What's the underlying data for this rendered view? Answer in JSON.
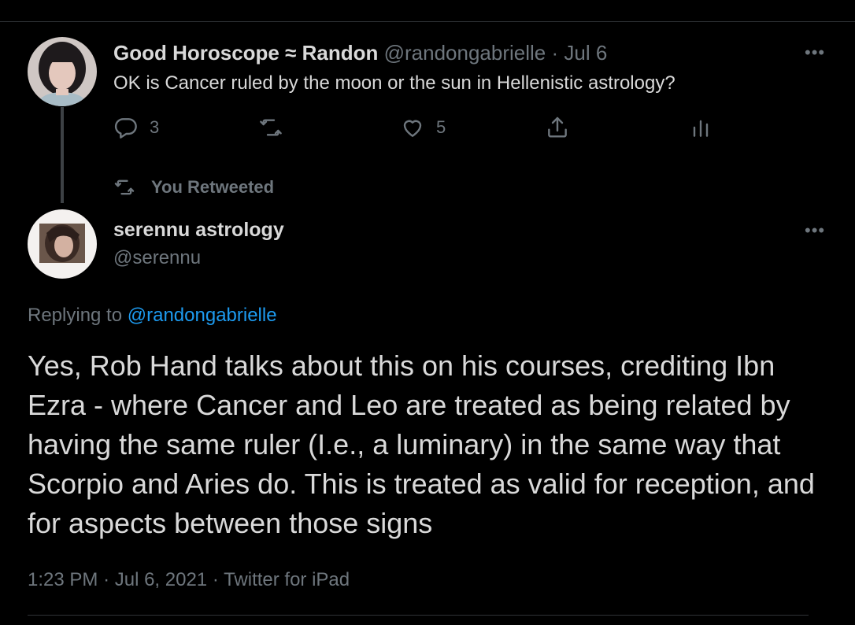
{
  "tweet1": {
    "display_name": "Good Horoscope ≈ Randon",
    "handle": "@randongabrielle",
    "separator": "·",
    "date": "Jul 6",
    "text": "OK is Cancer ruled by the moon or the sun in Hellenistic astrology?",
    "more_label": "•••",
    "reply_count": "3",
    "like_count": "5",
    "icons": [
      "reply-icon",
      "retweet-icon",
      "like-icon",
      "share-icon",
      "analytics-icon"
    ]
  },
  "retweet_banner": {
    "label": "You Retweeted"
  },
  "tweet2": {
    "display_name": "serennu astrology",
    "handle": "@serennu",
    "more_label": "•••",
    "replying_prefix": "Replying to",
    "replying_to": "@randongabrielle",
    "text": "Yes, Rob Hand talks about this on his courses, crediting Ibn Ezra - where Cancer and Leo are treated as being related by having the same ruler (I.e., a luminary) in the same way that Scorpio and Aries do. This is treated as valid for reception, and for aspects between those signs",
    "time": "1:23 PM",
    "date": "Jul 6, 2021",
    "source": "Twitter for iPad"
  },
  "colors": {
    "background": "#000000",
    "text": "#d9d9d9",
    "muted": "#6e767d",
    "link": "#1d9bf0",
    "border": "#2f3336"
  }
}
